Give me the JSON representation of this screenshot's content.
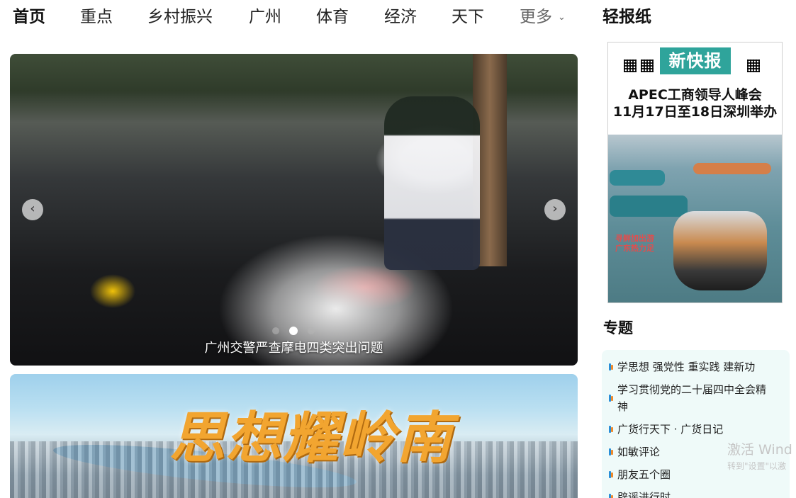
{
  "nav": {
    "items": [
      "首页",
      "重点",
      "乡村振兴",
      "广州",
      "体育",
      "经济",
      "天下",
      "更多"
    ],
    "light_paper": "轻报纸"
  },
  "hero": {
    "caption": "广州交警严查摩电四类突出问题",
    "slide_count": 3,
    "active_slide": 2
  },
  "banner": {
    "title": "思想耀岭南"
  },
  "newspaper": {
    "masthead": "新快报",
    "headline_line1": "APEC工商领导人峰会",
    "headline_line2": "11月17日至18日深圳举办",
    "photo_caption_line1": "寻鲜加出游",
    "photo_caption_line2": "广东热力足"
  },
  "topics": {
    "title": "专题",
    "items": [
      "学思想 强党性 重实践 建新功",
      "学习贯彻党的二十届四中全会精神",
      "广货行天下 · 广货日记",
      "如敏评论",
      "朋友五个圈",
      "辟谣进行时"
    ]
  },
  "watermark": {
    "line1": "激活 Wind",
    "line2": "转到\"设置\"以激"
  },
  "colors": {
    "accent_teal": "#5fc9c9",
    "masthead_teal": "#2fa49b",
    "topic_panel_bg": "#effaf9"
  }
}
